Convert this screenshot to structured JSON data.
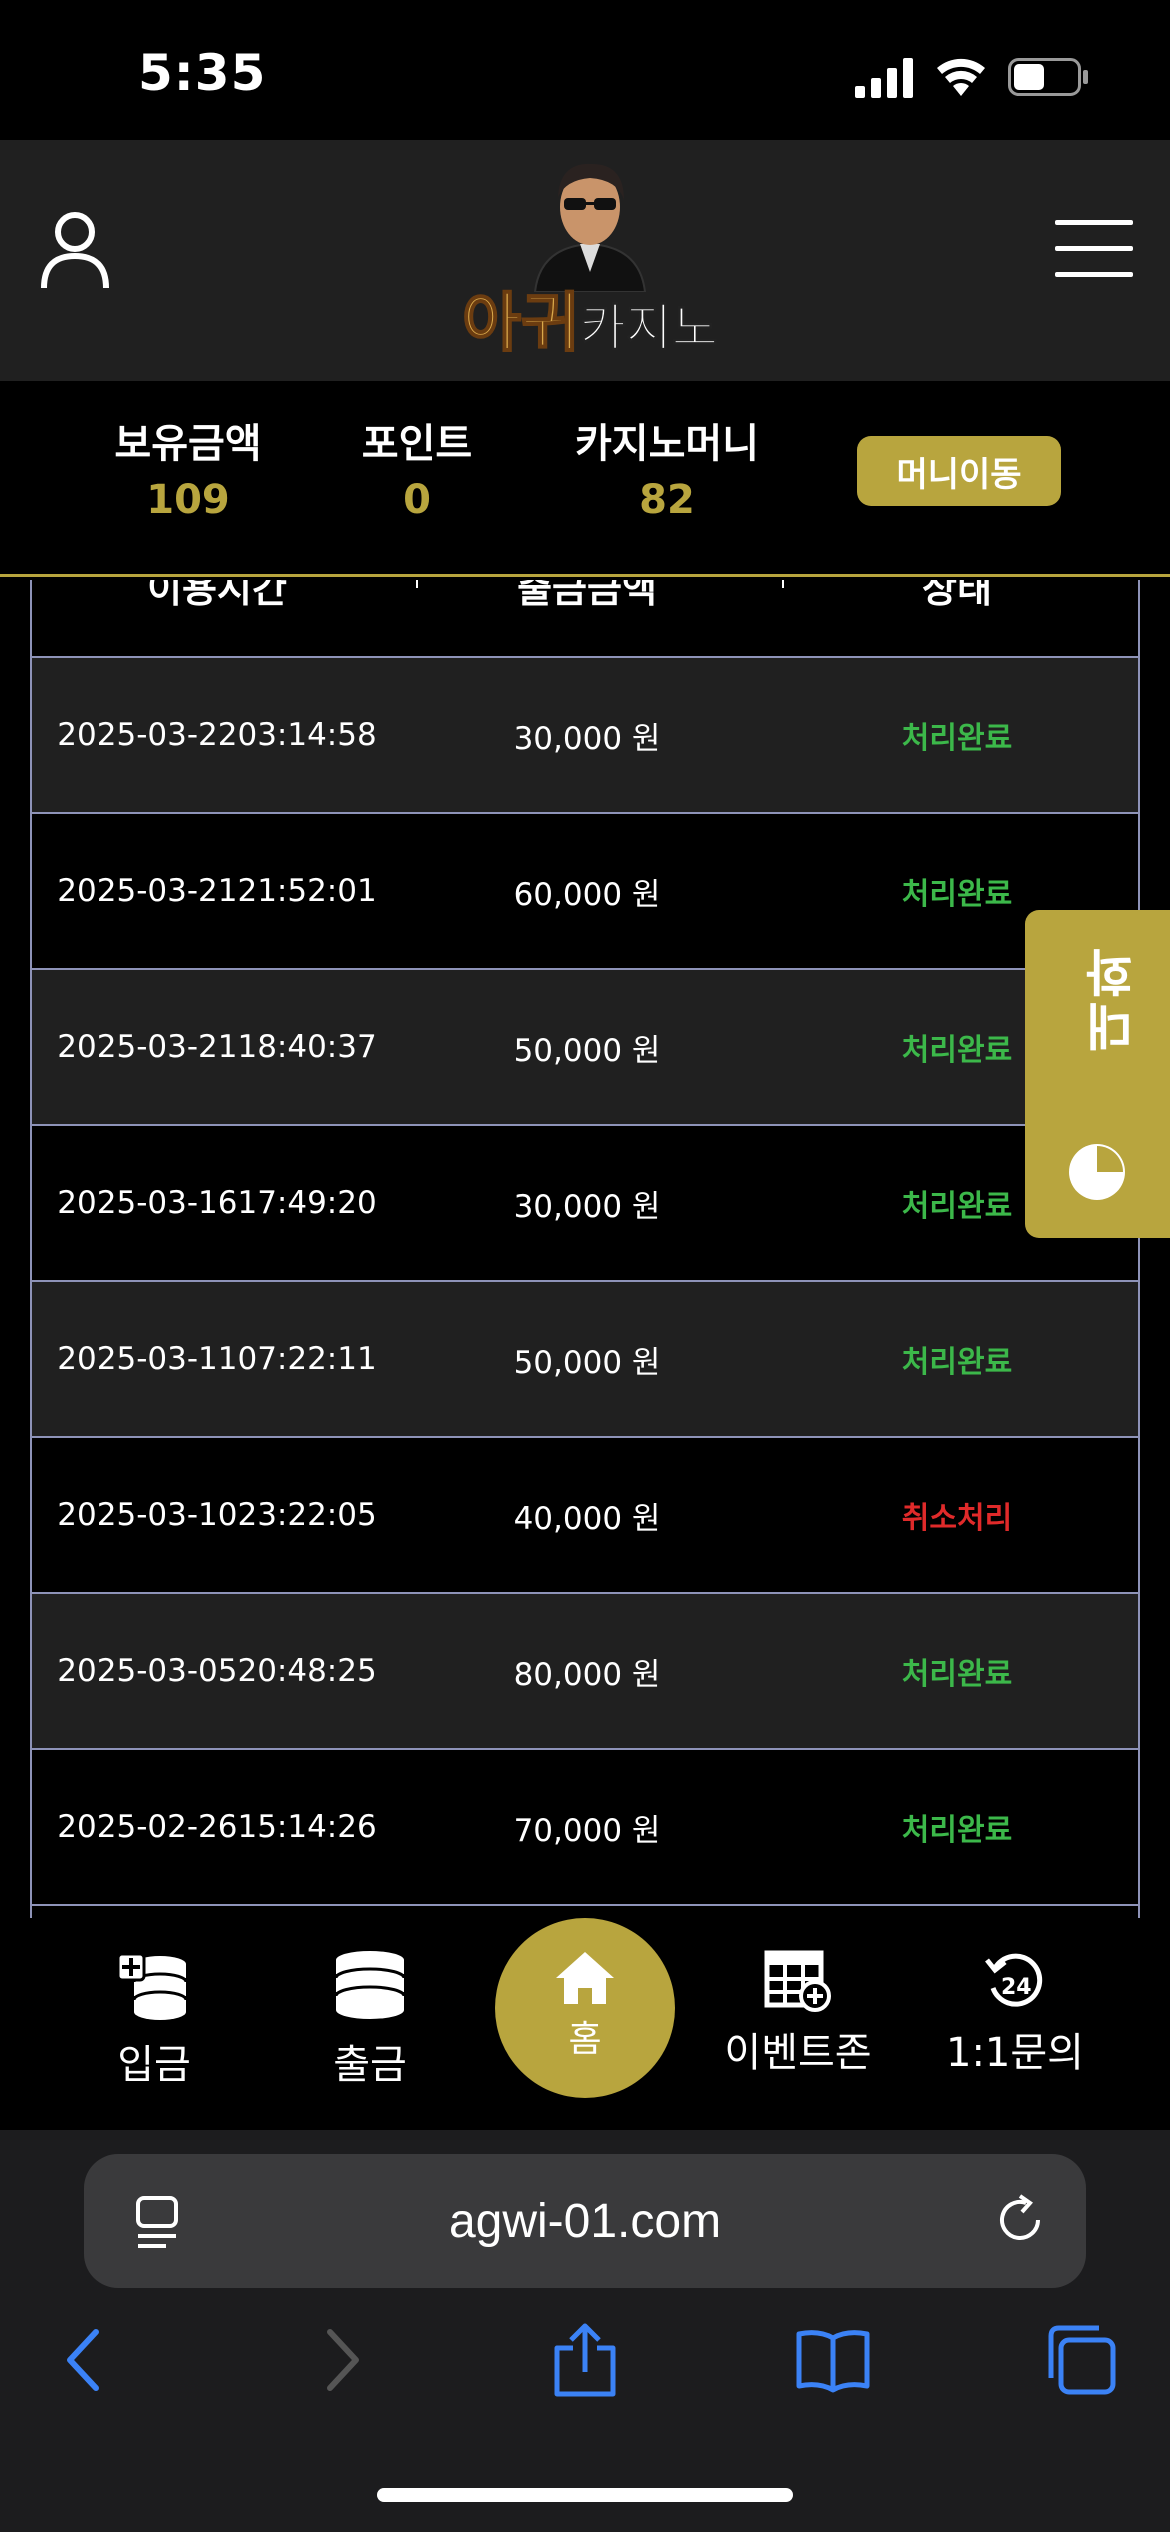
{
  "status_bar": {
    "time": "5:35"
  },
  "header": {
    "logo_accent": "아귀",
    "logo_rest": "카지노"
  },
  "balance": {
    "items": [
      {
        "label": "보유금액",
        "value": "109"
      },
      {
        "label": "포인트",
        "value": "0"
      },
      {
        "label": "카지노머니",
        "value": "82"
      }
    ],
    "move_button": "머니이동"
  },
  "table": {
    "headers": [
      "이용시간",
      "출금금액",
      "상태"
    ],
    "rows": [
      {
        "date": "2025-03-22",
        "time": "03:14:58",
        "amount": "30,000 원",
        "status": "처리완료",
        "status_type": "done"
      },
      {
        "date": "2025-03-21",
        "time": "21:52:01",
        "amount": "60,000 원",
        "status": "처리완료",
        "status_type": "done"
      },
      {
        "date": "2025-03-21",
        "time": "18:40:37",
        "amount": "50,000 원",
        "status": "처리완료",
        "status_type": "done"
      },
      {
        "date": "2025-03-16",
        "time": "17:49:20",
        "amount": "30,000 원",
        "status": "처리완료",
        "status_type": "done"
      },
      {
        "date": "2025-03-11",
        "time": "07:22:11",
        "amount": "50,000 원",
        "status": "처리완료",
        "status_type": "done",
        "single_line": true
      },
      {
        "date": "2025-03-10",
        "time": "23:22:05",
        "amount": "40,000 원",
        "status": "취소처리",
        "status_type": "cancel"
      },
      {
        "date": "2025-03-05",
        "time": "20:48:25",
        "amount": "80,000 원",
        "status": "처리완료",
        "status_type": "done"
      },
      {
        "date": "2025-02-26",
        "time": "15:14:26",
        "amount": "70,000 원",
        "status": "처리완료",
        "status_type": "done"
      }
    ]
  },
  "chat_tab": {
    "label": "대화"
  },
  "bottom_nav": {
    "deposit": "입금",
    "withdraw": "출금",
    "home": "홈",
    "events": "이벤트존",
    "inquiry": "1:1문의"
  },
  "browser": {
    "url": "agwi-01.com"
  },
  "colors": {
    "accent": "#b8a53e",
    "done": "#3cb84a",
    "cancel": "#e02a2a",
    "row_dark": "#202020",
    "border": "#8e93b8"
  }
}
